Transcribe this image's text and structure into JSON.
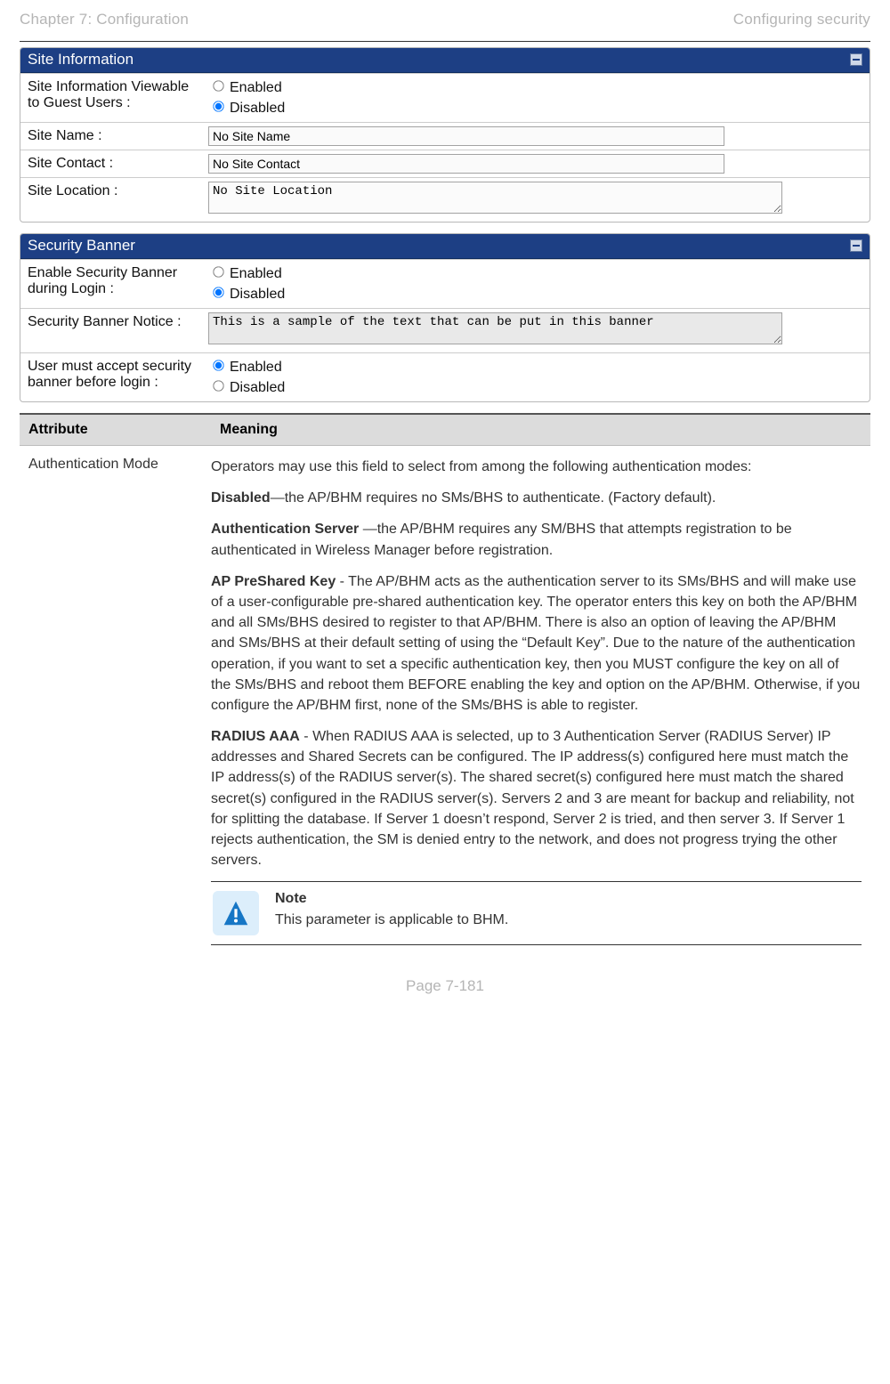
{
  "header": {
    "left": "Chapter 7:  Configuration",
    "right": "Configuring security"
  },
  "panels": {
    "site": {
      "title": "Site Information",
      "rows": {
        "guest_label": "Site Information Viewable to Guest Users :",
        "guest_opt_enabled": "Enabled",
        "guest_opt_disabled": "Disabled",
        "name_label": "Site Name :",
        "name_value": "No Site Name",
        "contact_label": "Site Contact :",
        "contact_value": "No Site Contact",
        "location_label": "Site Location :",
        "location_value": "No Site Location"
      }
    },
    "security": {
      "title": "Security Banner",
      "rows": {
        "enable_label": "Enable Security Banner during Login :",
        "enable_opt_enabled": "Enabled",
        "enable_opt_disabled": "Disabled",
        "notice_label": "Security Banner Notice :",
        "notice_value": "This is a sample of the text that can be put in this banner",
        "accept_label": "User must accept security banner before login :",
        "accept_opt_enabled": "Enabled",
        "accept_opt_disabled": "Disabled"
      }
    }
  },
  "attr_table": {
    "head_attr": "Attribute",
    "head_meaning": "Meaning",
    "row1": {
      "attr": "Authentication Mode",
      "p1": "Operators may use this field to select from among the following authentication modes:",
      "p2_bold": "Disabled",
      "p2_rest": "—the AP/BHM requires no SMs/BHS to authenticate. (Factory default).",
      "p3_bold": "Authentication Server ",
      "p3_rest": "—the AP/BHM requires any SM/BHS that attempts registration to be authenticated in Wireless Manager before registration.",
      "p4_bold": "AP PreShared Key",
      "p4_rest": " - The AP/BHM acts as the authentication server to its SMs/BHS and will make use of a user-configurable pre-shared authentication key. The operator enters this key on both the AP/BHM and all SMs/BHS desired to register to that AP/BHM. There is also an option of leaving the AP/BHM and SMs/BHS at their default setting of using the “Default Key”. Due to the nature of the authentication operation, if you want to set a specific authentication key, then you MUST configure the key on all of the SMs/BHS and reboot them BEFORE enabling the key and option on the AP/BHM. Otherwise, if you configure the AP/BHM first, none of the SMs/BHS is able to register.",
      "p5_bold": "RADIUS AAA",
      "p5_rest": " - When RADIUS AAA is selected, up to 3 Authentication Server (RADIUS Server) IP addresses and Shared Secrets can be configured. The IP address(s) configured here must match the IP address(s) of the RADIUS server(s). The shared secret(s) configured here must match the shared secret(s) configured in the RADIUS server(s). Servers 2 and 3 are meant for backup and reliability, not for splitting the database. If Server 1 doesn’t respond, Server 2 is tried, and then server 3. If Server 1 rejects authentication, the SM is denied entry to the network, and does not progress trying the other servers.",
      "note_title": "Note",
      "note_text": "This parameter is applicable to BHM."
    }
  },
  "footer": "Page 7-181"
}
